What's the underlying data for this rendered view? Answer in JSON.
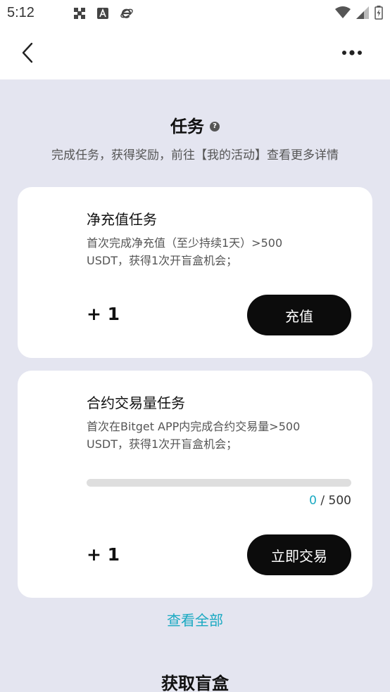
{
  "status_bar": {
    "time": "5:12",
    "left_icons": [
      "grid-app-icon",
      "a-font-icon",
      "browser-e-icon"
    ],
    "right_icons": [
      "wifi-icon",
      "signal-icon",
      "battery-icon"
    ]
  },
  "header": {
    "back_icon": "chevron-left-icon",
    "more_icon": "more-dots-icon"
  },
  "tasks_section": {
    "title": "任务",
    "help_icon": "question-circle-icon",
    "subtitle": "完成任务，获得奖励，前往【我的活动】查看更多详情"
  },
  "tasks": [
    {
      "title": "净充值任务",
      "description": "首次完成净充值（至少持续1天）>500 USDT，获得1次开盲盒机会；",
      "reward": "+ 1",
      "button_label": "充值"
    },
    {
      "title": "合约交易量任务",
      "description": "首次在Bitget APP内完成合约交易量>500 USDT，获得1次开盲盒机会；",
      "progress": {
        "current": "0",
        "separator": " / ",
        "target": "500",
        "fraction": 0
      },
      "reward": "+ 1",
      "button_label": "立即交易"
    }
  ],
  "view_all": "查看全部",
  "blind_box_section": {
    "title": "获取盲盒"
  },
  "colors": {
    "accent": "#1aa9c2",
    "page_background": "#e4e5f0",
    "button_background": "#0c0c0c"
  }
}
